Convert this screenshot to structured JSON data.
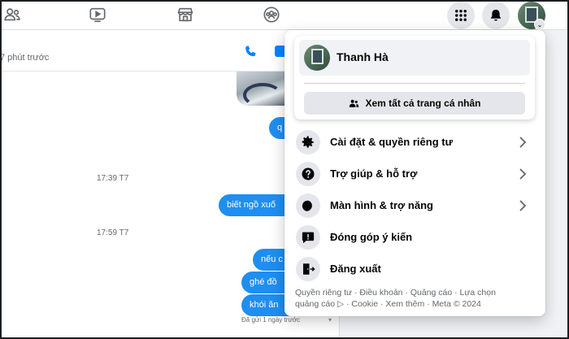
{
  "topbar": {
    "nav_icons": [
      "friends-icon",
      "watch-icon",
      "marketplace-icon",
      "groups-icon"
    ],
    "menu_icon": "grid-menu-icon",
    "notification_icon": "bell-icon",
    "account_chevron": "⌄"
  },
  "chat": {
    "active_status": "7 phút trước",
    "messages": [
      {
        "type": "outgoing",
        "text": "q"
      },
      {
        "type": "timestamp",
        "text": "17:39 T7"
      },
      {
        "type": "outgoing",
        "text": "biết ngồ xuố"
      },
      {
        "type": "timestamp",
        "text": "17:59 T7"
      },
      {
        "type": "outgoing",
        "text": "nếu c"
      },
      {
        "type": "outgoing",
        "text": "ghé đồ"
      },
      {
        "type": "outgoing",
        "text": "khói ăn"
      }
    ],
    "seen_status": "Đã gửi 1 ngày trước",
    "seen_caret": "▾"
  },
  "account_menu": {
    "profile_name": "Thanh Hà",
    "see_all_profiles": "Xem tất cả trang cá nhân",
    "items": [
      {
        "icon": "gear-icon",
        "label": "Cài đặt & quyền riêng tư",
        "has_submenu": true
      },
      {
        "icon": "help-icon",
        "label": "Trợ giúp & hỗ trợ",
        "has_submenu": true
      },
      {
        "icon": "moon-icon",
        "label": "Màn hình & trợ năng",
        "has_submenu": true
      },
      {
        "icon": "feedback-icon",
        "label": "Đóng góp ý kiến",
        "has_submenu": false
      },
      {
        "icon": "logout-icon",
        "label": "Đăng xuất",
        "has_submenu": false
      }
    ],
    "footer_line1": "Quyền riêng tư · Điều khoản · Quảng cáo · Lựa chọn",
    "footer_line2": "quảng cáo ▷ · Cookie · Xem thêm · Meta © 2024"
  },
  "colors": {
    "accent": "#0084ff",
    "bubble": "#1f8ef1",
    "menu_bg": "#ffffff",
    "icon_circle": "#e4e6eb",
    "text_secondary": "#65676b"
  }
}
